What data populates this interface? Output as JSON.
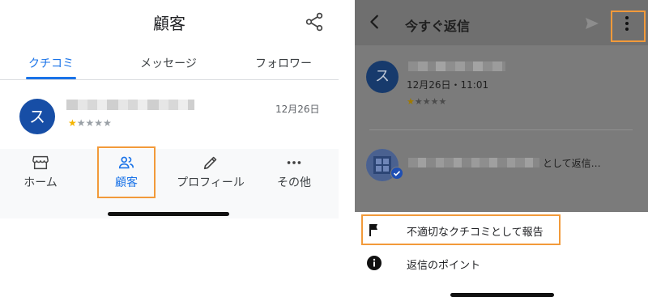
{
  "left": {
    "title": "顧客",
    "tabs": [
      {
        "label": "クチコミ",
        "active": true
      },
      {
        "label": "メッセージ",
        "active": false
      },
      {
        "label": "フォロワー",
        "active": false
      }
    ],
    "review": {
      "avatar_initial": "ス",
      "rating": 1,
      "max_rating": 5,
      "date": "12月26日"
    },
    "bottom_nav": [
      {
        "label": "ホーム",
        "icon": "storefront-icon",
        "active": false
      },
      {
        "label": "顧客",
        "icon": "people-icon",
        "active": true
      },
      {
        "label": "プロフィール",
        "icon": "pencil-icon",
        "active": false
      },
      {
        "label": "その他",
        "icon": "more-horizontal-icon",
        "active": false
      }
    ]
  },
  "right": {
    "title": "今すぐ返信",
    "review": {
      "avatar_initial": "ス",
      "date_time": "12月26日・11:01",
      "rating": 1,
      "max_rating": 5
    },
    "reply_as_text": "として返信…",
    "menu": [
      {
        "label": "不適切なクチコミとして報告",
        "icon": "flag-icon"
      },
      {
        "label": "返信のポイント",
        "icon": "info-icon"
      }
    ]
  },
  "colors": {
    "accent": "#1a73e8",
    "highlight": "#f29a3a",
    "avatar": "#174ea6",
    "star": "#f4b400"
  }
}
